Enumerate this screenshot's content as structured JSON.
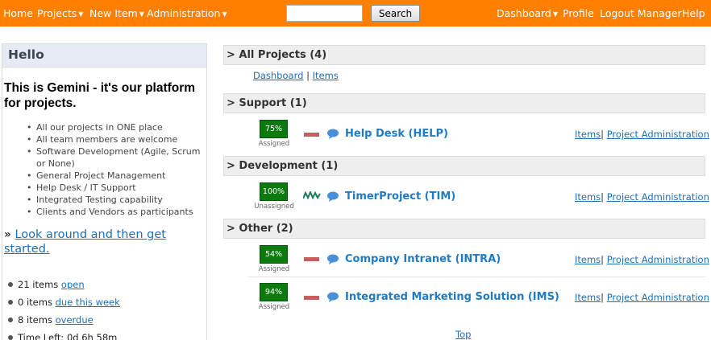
{
  "nav": {
    "home": "Home",
    "projects": "Projects",
    "new_item": "New Item",
    "administration": "Administration",
    "search_button": "Search",
    "search_value": "",
    "dashboard": "Dashboard",
    "profile": "Profile",
    "logout": "Logout Manager",
    "help": "Help"
  },
  "sidebar": {
    "hello": "Hello",
    "intro": "This is Gemini - it's our platform for projects.",
    "features": [
      "All our projects in ONE place",
      "All team members are welcome",
      "Software Development (Agile, Scrum or None)",
      "General Project Management",
      "Help Desk / IT Support",
      "Integrated Testing capability",
      "Clients and Vendors as participants"
    ],
    "look_prefix": "»",
    "look_link": "Look around and then get started.",
    "stats": [
      {
        "text": "21 items",
        "link": "open"
      },
      {
        "text": "0 items",
        "link": "due this week"
      },
      {
        "text": "8 items",
        "link": "overdue"
      },
      {
        "text": "Time Left: 0d 6h 58m",
        "link": ""
      }
    ]
  },
  "main": {
    "all_projects": "> All Projects (4)",
    "top_links": {
      "dashboard": "Dashboard",
      "sep": "|",
      "items": "Items"
    },
    "groups": [
      {
        "title": ">  Support (1)"
      },
      {
        "title": ">  Development (1)"
      },
      {
        "title": "> Other (2)"
      }
    ],
    "projects": [
      {
        "percent": "75%",
        "status": "Assigned",
        "name": "Help Desk (HELP)",
        "trend": "flat"
      },
      {
        "percent": "100%",
        "status": "Unassigned",
        "name": "TimerProject (TIM)",
        "trend": "zigzag"
      },
      {
        "percent": "54%",
        "status": "Assigned",
        "name": "Company Intranet (INTRA)",
        "trend": "flat"
      },
      {
        "percent": "94%",
        "status": "Assigned",
        "name": "Integrated Marketing Solution (IMS)",
        "trend": "flat"
      }
    ],
    "items_link": "Items",
    "link_sep": "|",
    "admin_link": "Project Administration",
    "top": "Top"
  },
  "colors": {
    "topbar": "#ff7f00",
    "progress": "#0c7a0c",
    "link": "#1e6fb5",
    "project_name": "#1e7bc4",
    "priority": "#c0615f",
    "trend": "#1e7a5a"
  },
  "icons": {
    "caret": "chevron-down-icon",
    "priority": "priority-bar-icon",
    "trend": "trend-zigzag-icon",
    "comment": "speech-bubble-icon"
  }
}
